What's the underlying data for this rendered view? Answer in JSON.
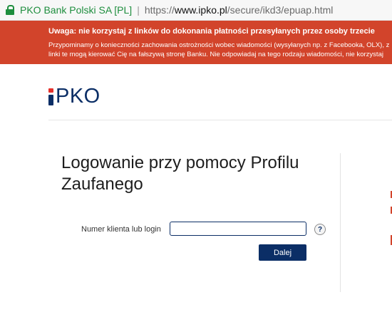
{
  "address_bar": {
    "site_name": "PKO Bank Polski SA [PL]",
    "separator": "|",
    "url_scheme": "https://",
    "url_host": "www.ipko.pl",
    "url_path": "/secure/ikd3/epuap.html"
  },
  "banner": {
    "headline": "Uwaga: nie korzystaj z linków do dokonania płatności przesyłanych przez osoby trzecie",
    "line1": "Przypominamy o konieczności zachowania ostrożności wobec wiadomości (wysyłanych np. z Facebooka, OLX), z",
    "line2": "linki te mogą kierować Cię na fałszywą stronę Banku. Nie odpowiadaj na tego rodzaju wiadomości, nie korzystaj"
  },
  "logo": {
    "text": "PKO"
  },
  "page": {
    "title": "Logowanie przy pomocy Profilu Zaufanego"
  },
  "form": {
    "login_label": "Numer klienta lub login",
    "login_value": "",
    "help_symbol": "?",
    "submit_label": "Dalej"
  },
  "colors": {
    "brand_navy": "#0b2e66",
    "banner_red": "#d2442b",
    "secure_green": "#1e8e3e"
  }
}
